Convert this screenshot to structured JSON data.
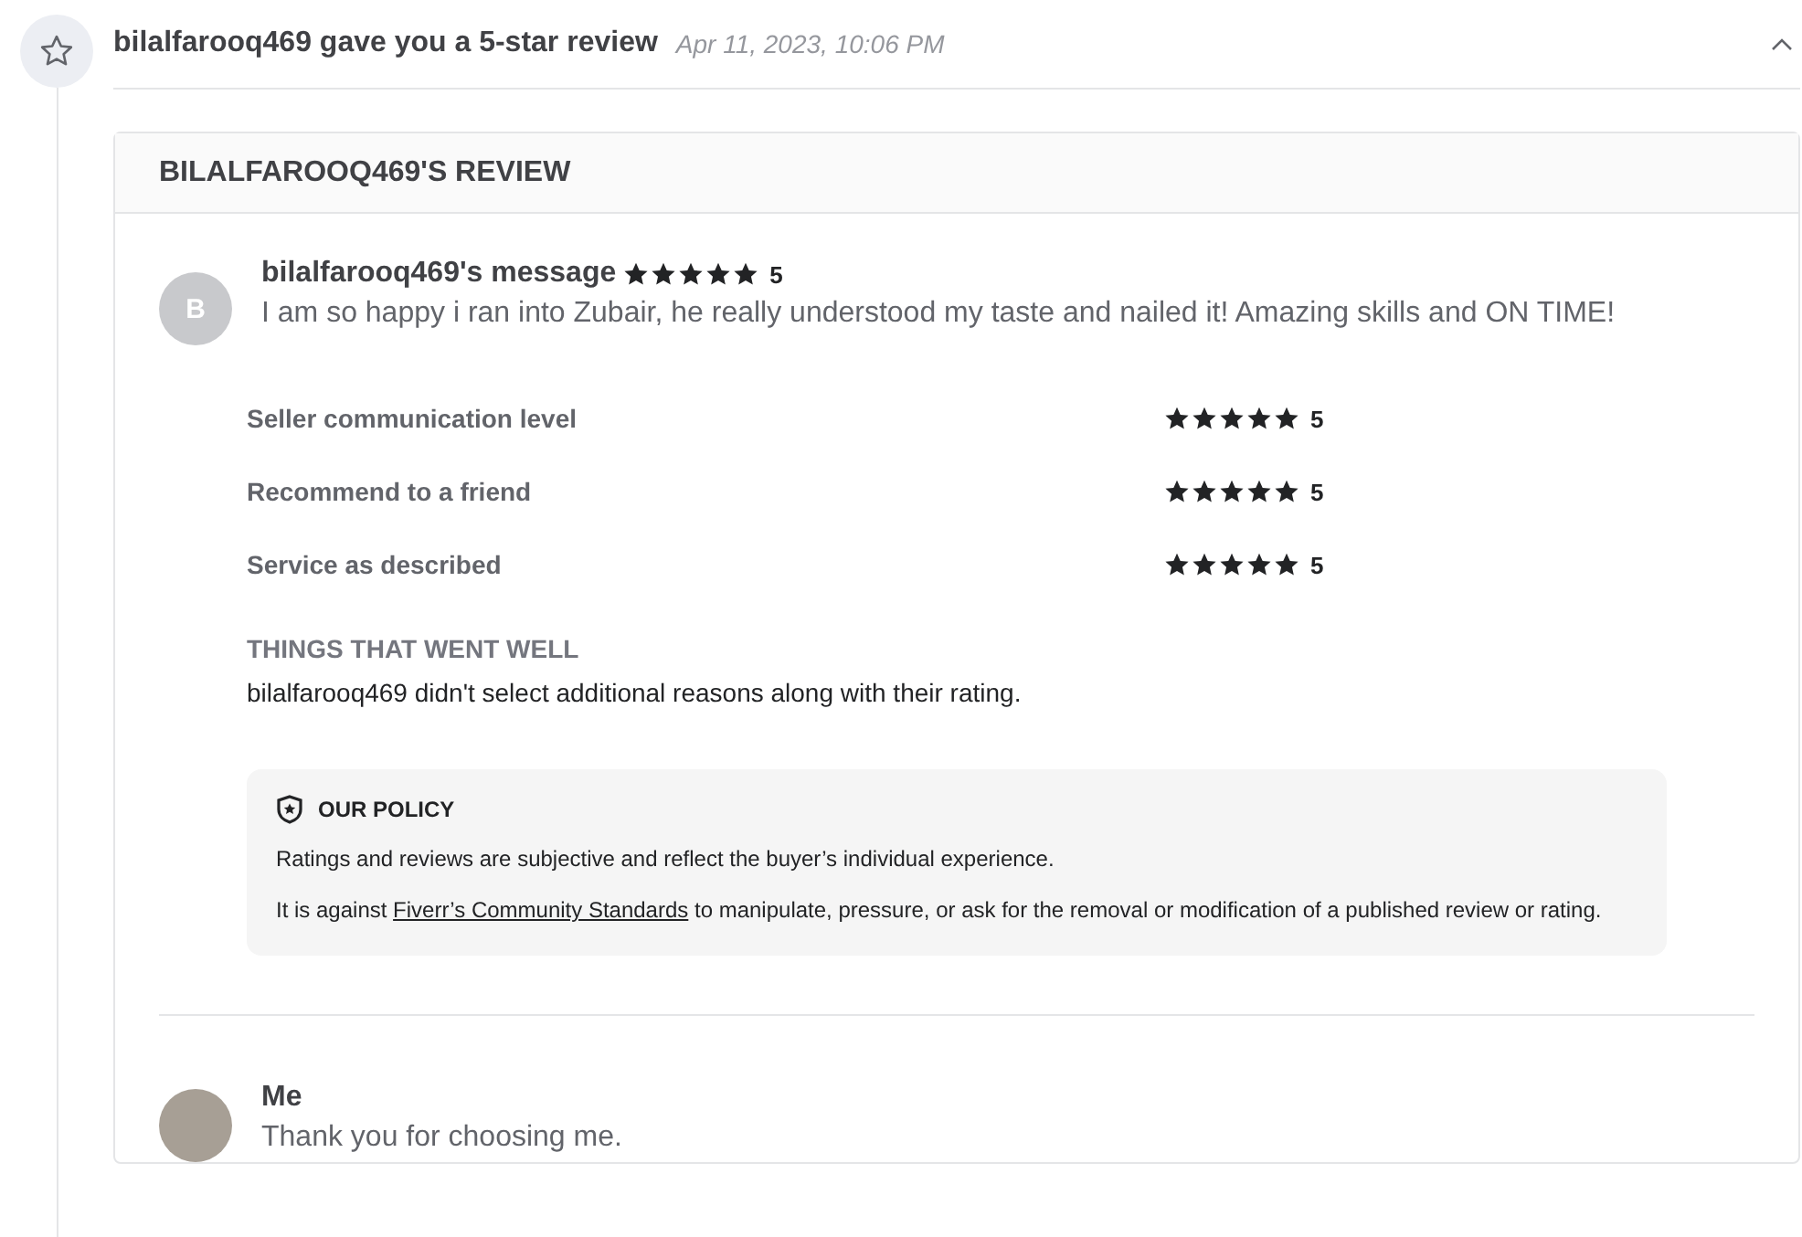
{
  "event": {
    "title": "bilalfarooq469 gave you a 5-star review",
    "time": "Apr 11, 2023, 10:06 PM",
    "expanded": true
  },
  "review": {
    "heading": "BILALFAROOQ469'S REVIEW",
    "message": {
      "avatar_letter": "B",
      "author": "bilalfarooq469's message",
      "stars": 5,
      "rating": "5",
      "text": "I am so happy i ran into Zubair, he really understood my taste and nailed it! Amazing skills and ON TIME!"
    },
    "criteria": [
      {
        "label": "Seller communication level",
        "stars": 5,
        "rating": "5"
      },
      {
        "label": "Recommend to a friend",
        "stars": 5,
        "rating": "5"
      },
      {
        "label": "Service as described",
        "stars": 5,
        "rating": "5"
      }
    ],
    "went_well": {
      "heading": "THINGS THAT WENT WELL",
      "text": "bilalfarooq469 didn't select additional reasons along with their rating."
    },
    "policy": {
      "title": "OUR POLICY",
      "paragraph_1": "Ratings and reviews are subjective and reflect the buyer’s individual experience.",
      "paragraph_2_before": "It is against",
      "link": "Fiverr’s Community Standards",
      "paragraph_2_after": "to manipulate, pressure, or ask for the removal or modification of a published review or rating."
    },
    "reply": {
      "author": "Me",
      "text": "Thank you for choosing me."
    }
  }
}
